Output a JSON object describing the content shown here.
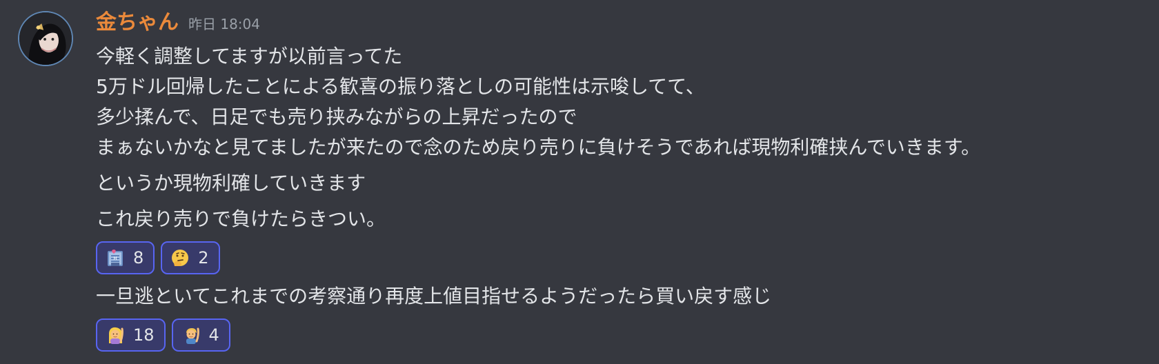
{
  "message": {
    "username": "金ちゃん",
    "timestamp": "昨日 18:04",
    "avatar_icon": "user-avatar",
    "username_color": "#eb8a3b",
    "group1_lines": [
      "今軽く調整してますが以前言ってた",
      "5万ドル回帰したことによる歓喜の振り落としの可能性は示唆してて、",
      "多少揉んで、日足でも売り挟みながらの上昇だったので",
      "まぁないかなと見てましたが来たので念のため戻り売りに負けそうであれば現物利確挟んでいきます。"
    ],
    "line2": "というか現物利確していきます",
    "line3": "これ戻り売りで負けたらきつい。",
    "reactions_group1": [
      {
        "emoji": "hotel-emoji",
        "count": "8"
      },
      {
        "emoji": "thinking-face-emoji",
        "count": "2"
      }
    ],
    "line4": "一旦逃といてこれまでの考察通り再度上値目指せるようだったら買い戻す感じ",
    "reactions_group2": [
      {
        "emoji": "woman-raising-hand-emoji",
        "count": "18"
      },
      {
        "emoji": "man-raising-hand-emoji",
        "count": "4"
      }
    ]
  },
  "colors": {
    "background": "#36383f",
    "text": "#e3e5e8",
    "timestamp": "#9aa0a8",
    "reaction_border": "#5865f2",
    "reaction_bg": "#383a6a"
  }
}
